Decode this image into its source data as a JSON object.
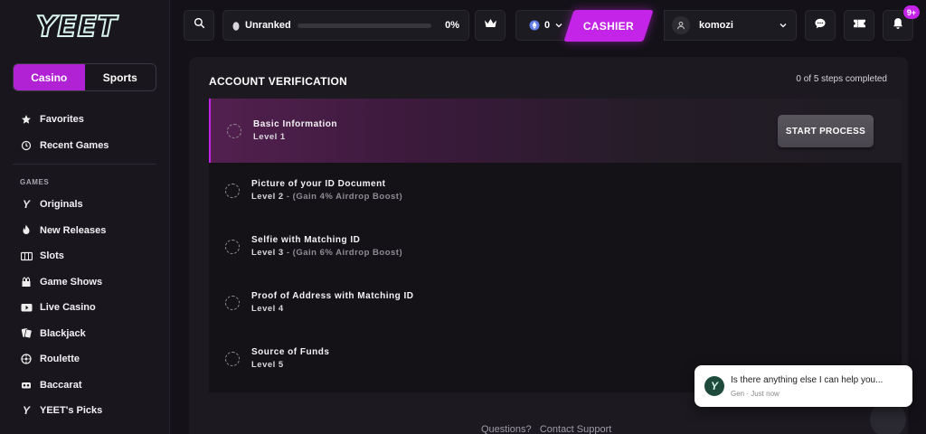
{
  "brand": {
    "logo_text": "YEET"
  },
  "sidebar": {
    "toggle": [
      {
        "label": "Casino",
        "active": true
      },
      {
        "label": "Sports",
        "active": false
      }
    ],
    "top_items": [
      {
        "label": "Favorites",
        "icon": "star-icon"
      },
      {
        "label": "Recent Games",
        "icon": "history-icon"
      }
    ],
    "section_label": "GAMES",
    "game_items": [
      {
        "label": "Originals",
        "icon": "yeet-originals-icon"
      },
      {
        "label": "New Releases",
        "icon": "flame-icon"
      },
      {
        "label": "Slots",
        "icon": "slots-icon"
      },
      {
        "label": "Game Shows",
        "icon": "game-shows-icon"
      },
      {
        "label": "Live Casino",
        "icon": "live-tv-icon"
      },
      {
        "label": "Blackjack",
        "icon": "cards-icon"
      },
      {
        "label": "Roulette",
        "icon": "roulette-icon"
      },
      {
        "label": "Baccarat",
        "icon": "baccarat-icon"
      },
      {
        "label": "YEET's Picks",
        "icon": "yeet-picks-icon"
      }
    ]
  },
  "topbar": {
    "rank": {
      "label": "Unranked",
      "progress": 0,
      "percent_text": "0%"
    },
    "balance": {
      "value": "0",
      "currency_icon": "ethereum-icon"
    },
    "cashier_label": "CASHIER",
    "username": "komozi",
    "notifications_badge": "9+"
  },
  "verification": {
    "title": "ACCOUNT VERIFICATION",
    "progress_text": "0 of 5 steps completed",
    "start_button": "START PROCESS",
    "steps": [
      {
        "title": "Basic Information",
        "level": "Level 1",
        "boost": "",
        "active": true
      },
      {
        "title": "Picture of your ID Document",
        "level": "Level 2",
        "boost": " - (Gain 4% Airdrop Boost)",
        "active": false
      },
      {
        "title": "Selfie with Matching ID",
        "level": "Level 3",
        "boost": " - (Gain 6% Airdrop Boost)",
        "active": false
      },
      {
        "title": "Proof of Address with Matching ID",
        "level": "Level 4",
        "boost": "",
        "active": false
      },
      {
        "title": "Source of Funds",
        "level": "Level 5",
        "boost": "",
        "active": false
      }
    ],
    "support_question": "Questions?",
    "support_link": "Contact Support"
  },
  "chat_popup": {
    "avatar_text": "Y",
    "message": "Is there anything else I can help you...",
    "sender": "Gen",
    "time": "Just now"
  },
  "colors": {
    "accent": "#c324e8",
    "background": "#141218",
    "sidebar": "#19171d",
    "card": "#1c1a20"
  }
}
